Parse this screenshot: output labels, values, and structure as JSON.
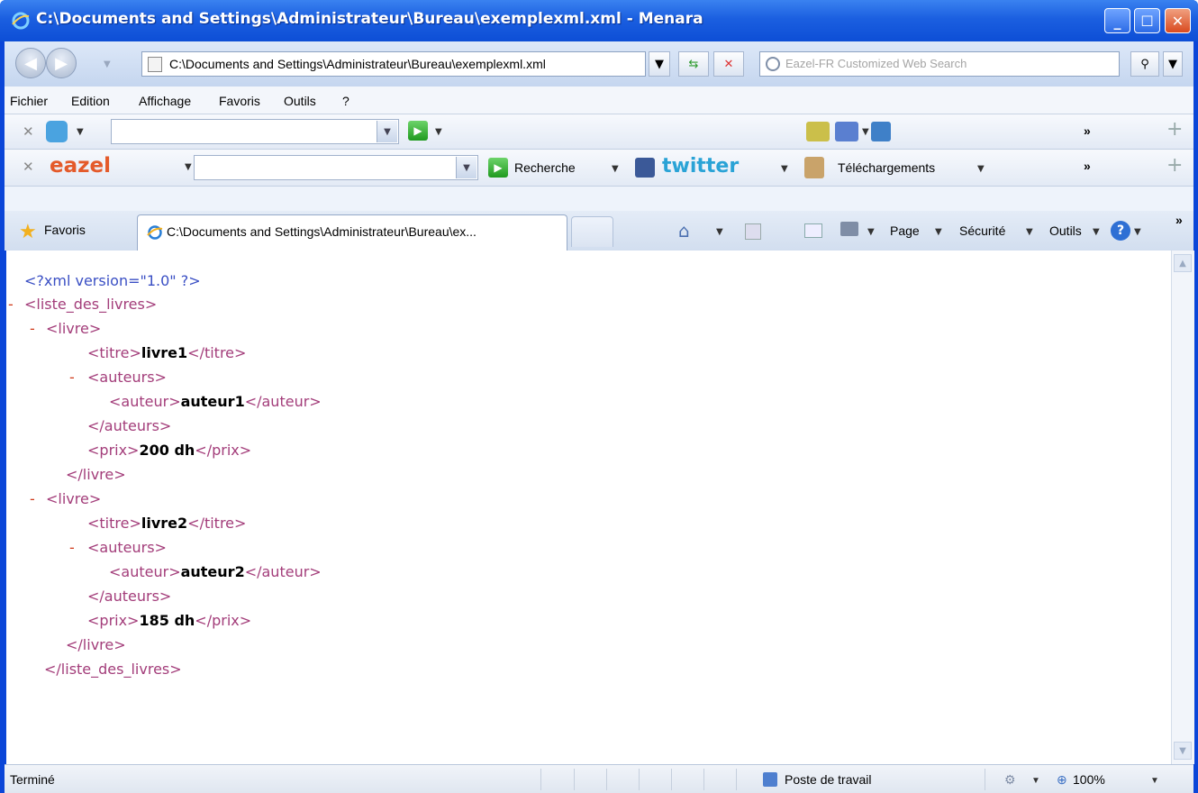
{
  "window": {
    "title": "C:\\Documents and Settings\\Administrateur\\Bureau\\exemplexml.xml - Menara"
  },
  "address_bar": {
    "url": "C:\\Documents and Settings\\Administrateur\\Bureau\\exemplexml.xml",
    "search_placeholder": "Eazel-FR Customized Web Search"
  },
  "menu": [
    "Fichier",
    "Edition",
    "Affichage",
    "Favoris",
    "Outils",
    "?"
  ],
  "toolbar2": {
    "brand": "eazel",
    "search_label": "Recherche",
    "twitter": "twitter",
    "downloads": "Téléchargements"
  },
  "tabs": {
    "favorites": "Favoris",
    "active_tab": "C:\\Documents and Settings\\Administrateur\\Bureau\\ex...",
    "commands": {
      "page": "Page",
      "security": "Sécurité",
      "tools": "Outils"
    }
  },
  "xml_lines": {
    "decl": "<?xml version=\"1.0\" ?>",
    "root_open": "<liste_des_livres>",
    "livre_open": "<livre>",
    "titre_open": "<titre>",
    "titre_close": "</titre>",
    "auteurs_open": "<auteurs>",
    "auteur_open": "<auteur>",
    "auteur_close": "</auteur>",
    "auteurs_close": "</auteurs>",
    "prix_open": "<prix>",
    "prix_close": "</prix>",
    "livre_close": "</livre>",
    "root_close": "</liste_des_livres>",
    "book1": {
      "titre": "livre1",
      "auteur": "auteur1",
      "prix": "200 dh"
    },
    "book2": {
      "titre": "livre2",
      "auteur": "auteur2",
      "prix": "185 dh"
    },
    "collapse_marker": "-"
  },
  "status_bar": {
    "left": "Terminé",
    "zone": "Poste de travail",
    "zoom": "100%"
  }
}
